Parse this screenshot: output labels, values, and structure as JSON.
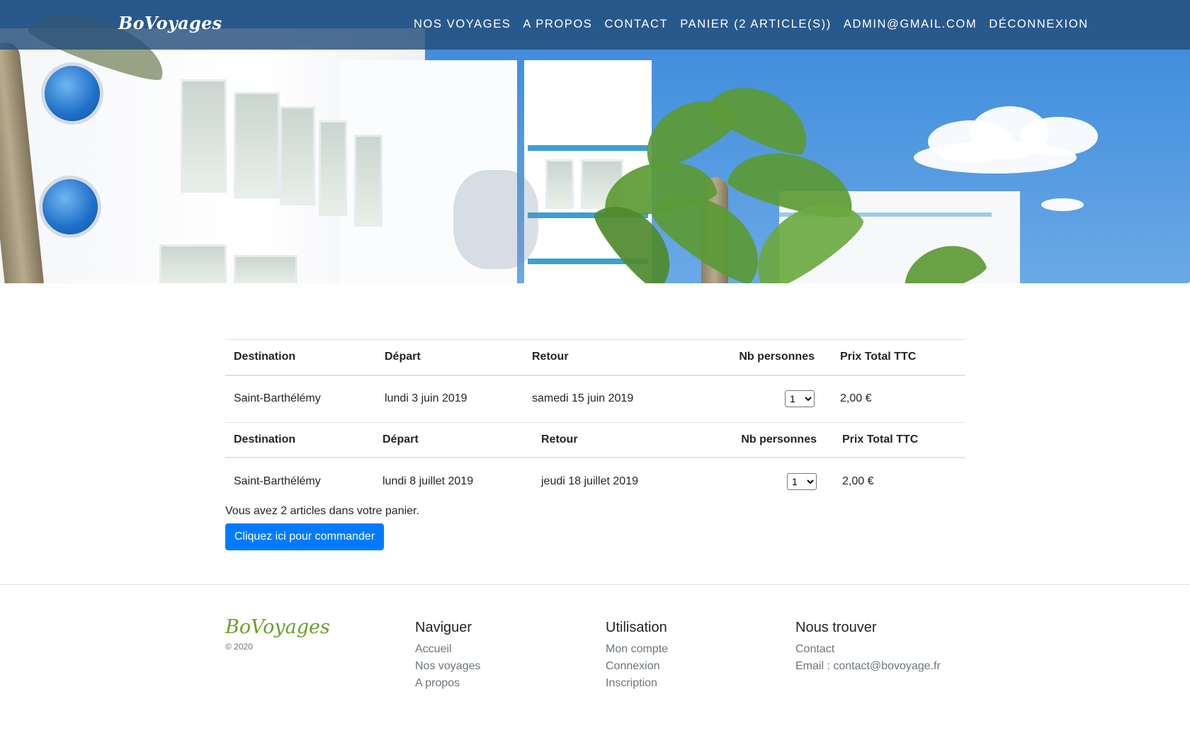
{
  "navbar": {
    "brand": "BoVoyages",
    "links": [
      "NOS VOYAGES",
      "A PROPOS",
      "CONTACT",
      "PANIER (2 ARTICLE(S))",
      "ADMIN@GMAIL.COM",
      "DÉCONNEXION"
    ]
  },
  "cart": {
    "headers": [
      "Destination",
      "Départ",
      "Retour",
      "Nb personnes",
      "Prix Total TTC"
    ],
    "items": [
      {
        "destination": "Saint-Barthélémy",
        "depart": "lundi 3 juin 2019",
        "retour": "samedi 15 juin 2019",
        "persons": "1",
        "price": "2,00 €"
      },
      {
        "destination": "Saint-Barthélémy",
        "depart": "lundi 8 juillet 2019",
        "retour": "jeudi 18 juillet 2019",
        "persons": "1",
        "price": "2,00 €"
      }
    ],
    "summary": "Vous avez 2 articles dans votre panier.",
    "order_button": "Cliquez ici pour commander"
  },
  "footer": {
    "brand": "BoVoyages",
    "copyright": "© 2020",
    "naviguer": {
      "title": "Naviguer",
      "links": [
        "Accueil",
        "Nos voyages",
        "A propos"
      ]
    },
    "utilisation": {
      "title": "Utilisation",
      "links": [
        "Mon compte",
        "Connexion",
        "Inscription"
      ]
    },
    "trouver": {
      "title": "Nous trouver",
      "links": [
        "Contact",
        "Email : contact@bovoyage.fr"
      ]
    }
  },
  "colors": {
    "primary": "#007bff",
    "navbar": "#234e7a",
    "footer_brand": "#6aa02a"
  }
}
